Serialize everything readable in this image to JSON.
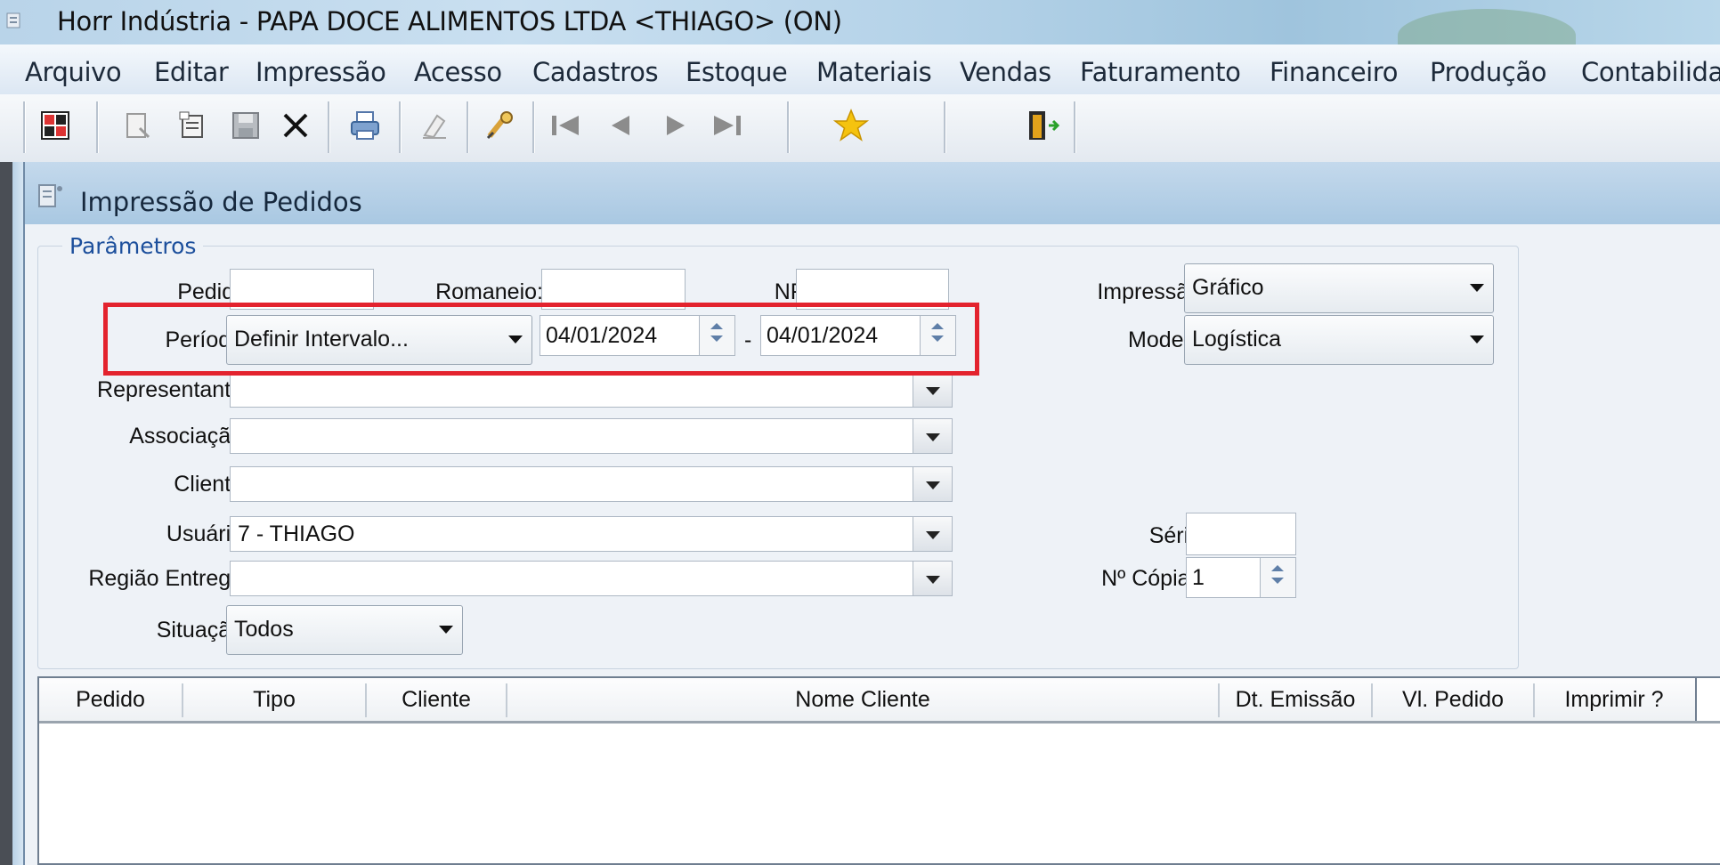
{
  "window": {
    "title": "Horr Indústria - PAPA DOCE ALIMENTOS LTDA <THIAGO> (ON)"
  },
  "menu": [
    "Arquivo",
    "Editar",
    "Impressão",
    "Acesso",
    "Cadastros",
    "Estoque",
    "Materiais",
    "Vendas",
    "Faturamento",
    "Financeiro",
    "Produção",
    "Contabilida"
  ],
  "toolbar": {
    "icons": [
      "calculator-icon",
      "new-record-icon",
      "edit-record-icon",
      "save-icon",
      "delete-icon",
      "print-icon",
      "clear-icon",
      "search-icon",
      "first-record-icon",
      "previous-record-icon",
      "next-record-icon",
      "last-record-icon",
      "favorite-star-icon",
      "exit-door-icon"
    ]
  },
  "form": {
    "title": "Impressão de Pedidos",
    "group_title": "Parâmetros",
    "labels": {
      "pedido": "Pedido:",
      "romaneio": "Romaneio:",
      "nf": "NF:",
      "periodo": "Período:",
      "representante": "Representante:",
      "associacao": "Associação:",
      "cliente": "Cliente:",
      "usuario": "Usuário:",
      "regiao": "Região Entrega:",
      "situacao": "Situação:",
      "impressao": "Impressão:",
      "modelo": "Modelo:",
      "serie": "Série:",
      "copias": "Nº Cópias:"
    },
    "values": {
      "pedido": "",
      "romaneio": "",
      "nf": "",
      "periodo": "Definir Intervalo...",
      "date_from": "04/01/2024",
      "date_sep": "-",
      "date_to": "04/01/2024",
      "representante": "",
      "associacao": "",
      "cliente": "",
      "usuario": "7 - THIAGO",
      "regiao": "",
      "situacao": "Todos",
      "impressao": "Gráfico",
      "modelo": "Logística",
      "serie": "",
      "copias": "1"
    }
  },
  "grid": {
    "columns": [
      "Pedido",
      "Tipo",
      "Cliente",
      "Nome Cliente",
      "Dt. Emissão",
      "Vl. Pedido",
      "Imprimir ?"
    ],
    "rows": []
  },
  "colors": {
    "highlight": "#e3232e",
    "group_title": "#1c4f9c"
  }
}
